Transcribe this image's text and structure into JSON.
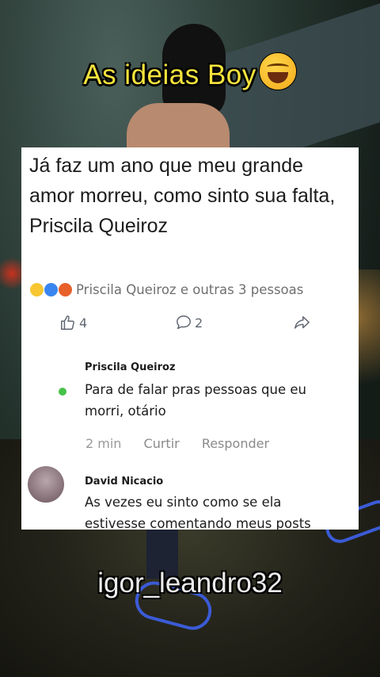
{
  "overlay": {
    "title": "As ideias Boy",
    "title_emoji": "rolling-on-floor-laughing",
    "handle": "igor_leandro32",
    "title_color": "#f6e33c"
  },
  "post": {
    "text": "Já faz um ano que meu grande amor morreu, como sinto sua falta, Priscila Queiroz",
    "reactions_text": "Priscila Queiroz e outras 3 pessoas",
    "reaction_icons": [
      "laugh-emoji",
      "wow-emoji",
      "angry-emoji"
    ],
    "likes": "4",
    "comments": "2",
    "share_icon": "share-icon"
  },
  "comments": [
    {
      "name": "Priscila Queiroz",
      "text": "Para de falar pras pessoas que eu morri, otário",
      "time": "2 min",
      "like_label": "Curtir",
      "reply_label": "Responder",
      "online": true
    },
    {
      "name": "David Nicacio",
      "text": "As vezes eu sinto como se ela estivesse comentando meus posts"
    }
  ]
}
